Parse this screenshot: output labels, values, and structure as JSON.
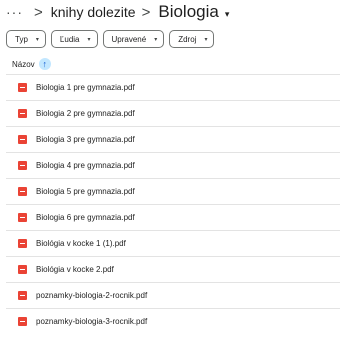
{
  "breadcrumb": {
    "more": "···",
    "separator": ">",
    "parent": "knihy dolezite",
    "current": "Biologia",
    "current_caret": "▾"
  },
  "filters": [
    {
      "label": "Typ",
      "caret": "▾"
    },
    {
      "label": "Ľudia",
      "caret": "▾"
    },
    {
      "label": "Upravené",
      "caret": "▾"
    },
    {
      "label": "Zdroj",
      "caret": "▾"
    }
  ],
  "sort": {
    "label": "Názov",
    "arrow": "↑"
  },
  "files": [
    {
      "name": "Biologia 1 pre gymnazia.pdf",
      "icon": "pdf-icon"
    },
    {
      "name": "Biologia 2 pre gymnazia.pdf",
      "icon": "pdf-icon"
    },
    {
      "name": "Biologia 3 pre gymnazia.pdf",
      "icon": "pdf-icon"
    },
    {
      "name": "Biologia 4 pre gymnazia.pdf",
      "icon": "pdf-icon"
    },
    {
      "name": "Biologia 5 pre gymnazia.pdf",
      "icon": "pdf-icon"
    },
    {
      "name": "Biologia 6 pre gymnazia.pdf",
      "icon": "pdf-icon"
    },
    {
      "name": "Biológia v kocke 1 (1).pdf",
      "icon": "pdf-icon"
    },
    {
      "name": "Biológia v kocke 2.pdf",
      "icon": "pdf-icon"
    },
    {
      "name": "poznamky-biologia-2-rocnik.pdf",
      "icon": "pdf-icon"
    },
    {
      "name": "poznamky-biologia-3-rocnik.pdf",
      "icon": "pdf-icon"
    }
  ],
  "colors": {
    "pdf_red": "#ea4335",
    "sort_chip_bg": "#c2e7ff",
    "sort_arrow": "#0b57d0",
    "divider": "#e3e3e3"
  }
}
